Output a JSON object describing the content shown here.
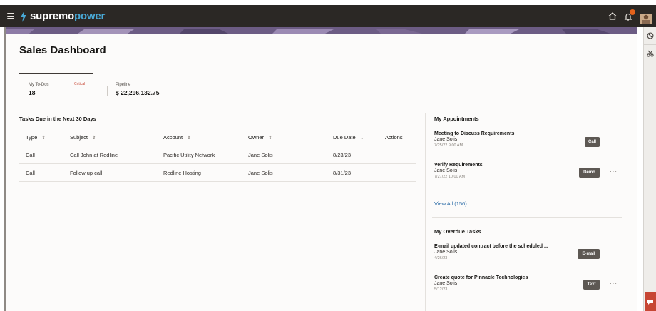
{
  "app": {
    "brand_part1": "supremo",
    "brand_part2": "power"
  },
  "colors": {
    "header_bg": "#2b2825",
    "brand_accent": "#49a9d6",
    "link": "#2e6ea8",
    "notification": "#e4621b",
    "critical": "#c74634"
  },
  "header": {
    "icons": [
      "menu-icon",
      "home-icon",
      "bell-icon",
      "avatar"
    ]
  },
  "right_rail": {
    "icons": [
      "block-icon",
      "cut-icon",
      "chat-icon"
    ]
  },
  "page": {
    "title": "Sales Dashboard"
  },
  "metrics": {
    "todos": {
      "label": "My To-Dos",
      "value": "18",
      "badge": "Critical"
    },
    "pipeline": {
      "label": "Pipeline",
      "value": "$ 22,296,132.75"
    }
  },
  "tasks": {
    "title": "Tasks Due in the Next 30 Days",
    "columns": {
      "type": "Type",
      "subject": "Subject",
      "account": "Account",
      "owner": "Owner",
      "due_date": "Due Date",
      "actions": "Actions"
    },
    "rows": [
      {
        "type": "Call",
        "subject": "Call John at Redline",
        "account": "Pacific Utility Network",
        "owner": "Jane Solis",
        "due_date": "8/23/23",
        "actions": "···"
      },
      {
        "type": "Call",
        "subject": "Follow up call",
        "account": "Redline Hosting",
        "owner": "Jane Solis",
        "due_date": "8/31/23",
        "actions": "···"
      }
    ]
  },
  "appointments": {
    "title": "My Appointments",
    "items": [
      {
        "title": "Meeting to Discuss Requirements",
        "owner": "Jane Solis",
        "date": "7/25/22 9:00 AM",
        "tag": "Call",
        "more": "···"
      },
      {
        "title": "Verify Requirements",
        "owner": "Jane Solis",
        "date": "7/27/22 10:00 AM",
        "tag": "Demo",
        "more": "···"
      }
    ],
    "view_all": "View All (156)"
  },
  "overdue": {
    "title": "My Overdue Tasks",
    "items": [
      {
        "title": "E-mail updated contract before the scheduled ...",
        "owner": "Jane Solis",
        "date": "4/26/23",
        "tag": "E-mail",
        "more": "···"
      },
      {
        "title": "Create quote for Pinnacle Technologies",
        "owner": "Jane Solis",
        "date": "5/12/23",
        "tag": "Text",
        "more": "···"
      }
    ]
  }
}
